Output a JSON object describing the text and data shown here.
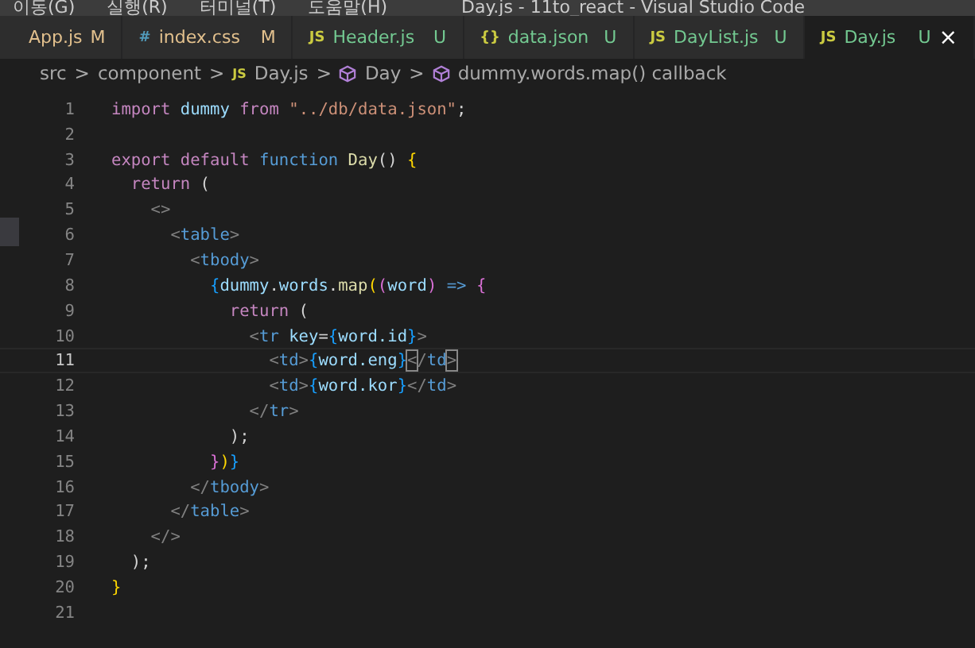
{
  "menu": [
    "이동(G)",
    "실행(R)",
    "터미널(T)",
    "도움말(H)"
  ],
  "window": {
    "title": "Day.js - 11to_react - Visual Studio Code"
  },
  "tabs": [
    {
      "label": "App.js",
      "status": "M",
      "selected": false
    },
    {
      "label": "index.css",
      "status": "M",
      "icon": "#",
      "selected": false
    },
    {
      "label": "Header.js",
      "status": "U",
      "icon": "JS",
      "selected": false
    },
    {
      "label": "data.json",
      "status": "U",
      "icon": "{}",
      "selected": false
    },
    {
      "label": "DayList.js",
      "status": "U",
      "icon": "JS",
      "selected": false
    },
    {
      "label": "Day.js",
      "status": "U",
      "icon": "JS",
      "selected": true,
      "close": "×"
    }
  ],
  "breadcrumb": [
    {
      "label": "src",
      "kind": "folder"
    },
    {
      "label": "component",
      "kind": "folder"
    },
    {
      "label": "Day.js",
      "kind": "file",
      "icon": "JS"
    },
    {
      "label": "Day",
      "kind": "symbol"
    },
    {
      "label": "dummy.words.map() callback",
      "kind": "symbol"
    }
  ],
  "separator": ">",
  "editor": {
    "lines": [
      {
        "number": "1",
        "current": false,
        "tokens": [
          {
            "t": "import",
            "kind": "kw"
          },
          {
            "t": " dummy ",
            "kind": "id"
          },
          {
            "t": "from",
            "kind": "kw"
          },
          {
            "t": " \"../db/data.json\"",
            "kind": "str"
          },
          {
            "t": ";",
            "kind": "p"
          }
        ]
      },
      {
        "number": "2",
        "current": false
      },
      {
        "number": "3",
        "current": false,
        "tokens": [
          {
            "t": "export default",
            "kind": "kw"
          },
          {
            "t": " function",
            "kind": "st"
          },
          {
            "t": " Day",
            "kind": "fn"
          },
          {
            "t": "() ",
            "kind": "p"
          },
          {
            "t": "{",
            "kind": "b1"
          }
        ]
      },
      {
        "number": "4",
        "current": false,
        "tokens": [
          {
            "t": "  return",
            "kind": "kw"
          },
          {
            "t": " (",
            "kind": "p"
          }
        ]
      },
      {
        "number": "5",
        "current": false,
        "tokens": [
          {
            "t": "    <>",
            "kind": "g"
          }
        ]
      },
      {
        "number": "6",
        "current": false,
        "tokens": [
          {
            "t": "      <",
            "kind": "g"
          },
          {
            "t": "table",
            "kind": "tag"
          },
          {
            "t": ">",
            "kind": "g"
          }
        ]
      },
      {
        "number": "7",
        "current": false,
        "tokens": [
          {
            "t": "        <",
            "kind": "g"
          },
          {
            "t": "tbody",
            "kind": "tag"
          },
          {
            "t": ">",
            "kind": "g"
          }
        ]
      },
      {
        "number": "8",
        "current": false,
        "tokens": [
          {
            "t": "          {",
            "kind": "b3"
          },
          {
            "t": "dummy",
            "kind": "id"
          },
          {
            "t": ".",
            "kind": "p"
          },
          {
            "t": "words",
            "kind": "id"
          },
          {
            "t": ".",
            "kind": "p"
          },
          {
            "t": "map",
            "kind": "fn"
          },
          {
            "t": "(",
            "kind": "b1"
          },
          {
            "t": "(",
            "kind": "b2"
          },
          {
            "t": "word",
            "kind": "id"
          },
          {
            "t": ")",
            "kind": "b2"
          },
          {
            "t": " => ",
            "kind": "st"
          },
          {
            "t": "{",
            "kind": "b2"
          }
        ]
      },
      {
        "number": "9",
        "current": false,
        "tokens": [
          {
            "t": "            return",
            "kind": "kw"
          },
          {
            "t": " (",
            "kind": "p"
          }
        ]
      },
      {
        "number": "10",
        "current": false,
        "tokens": [
          {
            "t": "              <",
            "kind": "g"
          },
          {
            "t": "tr",
            "kind": "tag"
          },
          {
            "t": " key",
            "kind": "id"
          },
          {
            "t": "=",
            "kind": "p"
          },
          {
            "t": "{",
            "kind": "b3"
          },
          {
            "t": "word.id",
            "kind": "id"
          },
          {
            "t": "}",
            "kind": "b3"
          },
          {
            "t": ">",
            "kind": "g"
          }
        ]
      },
      {
        "number": "11",
        "current": true,
        "tokens": [
          {
            "t": "                <",
            "kind": "g"
          },
          {
            "t": "td",
            "kind": "tag"
          },
          {
            "t": ">",
            "kind": "g"
          },
          {
            "t": "{",
            "kind": "b3"
          },
          {
            "t": "word.eng",
            "kind": "id"
          },
          {
            "t": "}",
            "kind": "b3"
          },
          {
            "t": "<",
            "kind": "m"
          },
          {
            "t": "/",
            "kind": "g"
          },
          {
            "t": "td",
            "kind": "tag"
          },
          {
            "t": ">",
            "kind": "m"
          }
        ]
      },
      {
        "number": "12",
        "current": false,
        "tokens": [
          {
            "t": "                <",
            "kind": "g"
          },
          {
            "t": "td",
            "kind": "tag"
          },
          {
            "t": ">",
            "kind": "g"
          },
          {
            "t": "{",
            "kind": "b3"
          },
          {
            "t": "word.kor",
            "kind": "id"
          },
          {
            "t": "}",
            "kind": "b3"
          },
          {
            "t": "</",
            "kind": "g"
          },
          {
            "t": "td",
            "kind": "tag"
          },
          {
            "t": ">",
            "kind": "g"
          }
        ]
      },
      {
        "number": "13",
        "current": false,
        "tokens": [
          {
            "t": "              </",
            "kind": "g"
          },
          {
            "t": "tr",
            "kind": "tag"
          },
          {
            "t": ">",
            "kind": "g"
          }
        ]
      },
      {
        "number": "14",
        "current": false,
        "tokens": [
          {
            "t": "            );",
            "kind": "p"
          }
        ]
      },
      {
        "number": "15",
        "current": false,
        "tokens": [
          {
            "t": "          }",
            "kind": "b2"
          },
          {
            "t": ")",
            "kind": "b1"
          },
          {
            "t": "}",
            "kind": "b3"
          }
        ]
      },
      {
        "number": "16",
        "current": false,
        "tokens": [
          {
            "t": "        </",
            "kind": "g"
          },
          {
            "t": "tbody",
            "kind": "tag"
          },
          {
            "t": ">",
            "kind": "g"
          }
        ]
      },
      {
        "number": "17",
        "current": false,
        "tokens": [
          {
            "t": "      </",
            "kind": "g"
          },
          {
            "t": "table",
            "kind": "tag"
          },
          {
            "t": ">",
            "kind": "g"
          }
        ]
      },
      {
        "number": "18",
        "current": false,
        "tokens": [
          {
            "t": "    </>",
            "kind": "g"
          }
        ]
      },
      {
        "number": "19",
        "current": false,
        "tokens": [
          {
            "t": "  );",
            "kind": "p"
          }
        ]
      },
      {
        "number": "20",
        "current": false,
        "tokens": [
          {
            "t": "}",
            "kind": "b1"
          }
        ]
      },
      {
        "number": "21",
        "current": false
      }
    ]
  }
}
